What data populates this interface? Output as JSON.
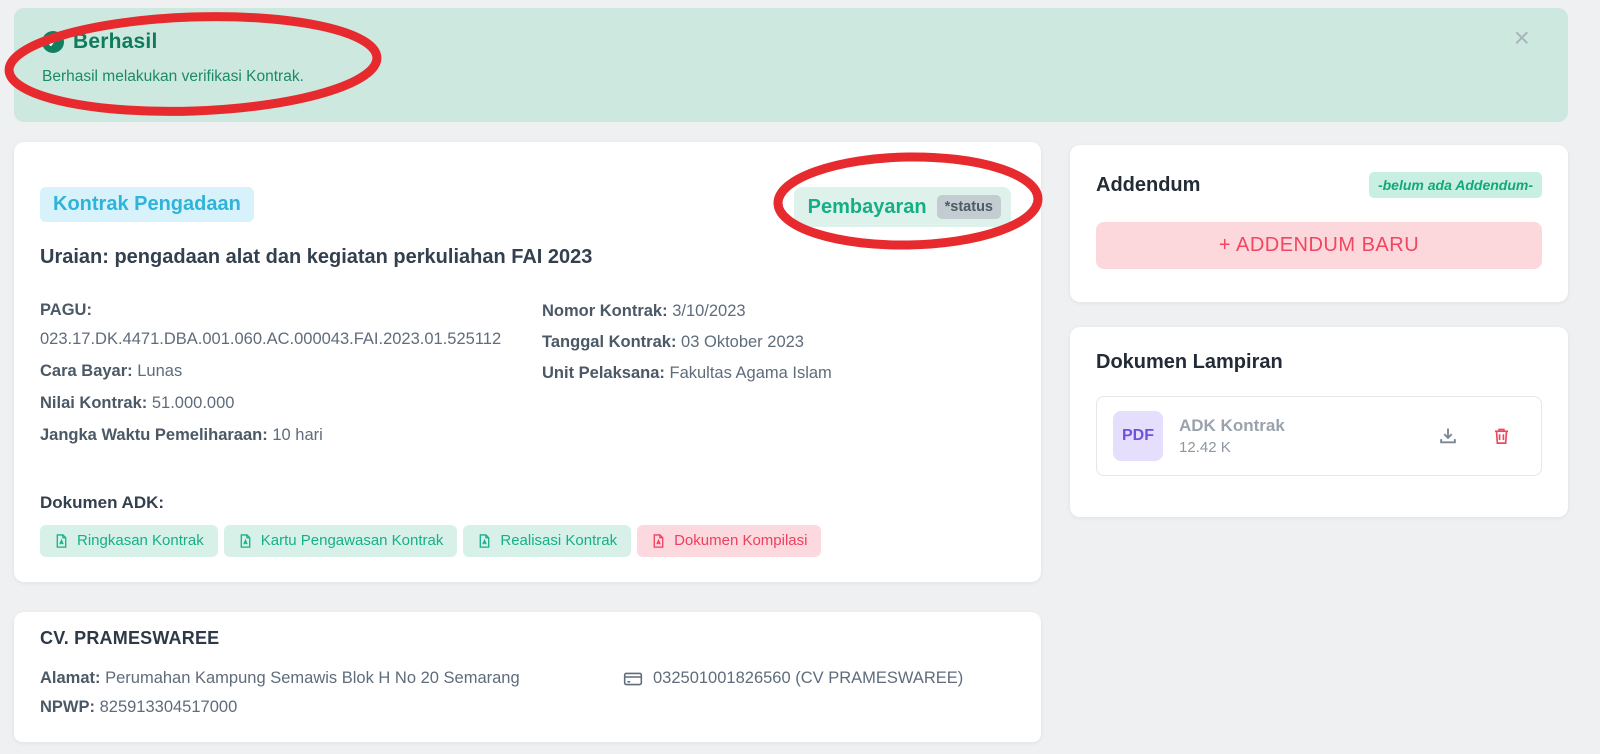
{
  "colors": {
    "page_bg": "#eef0f2",
    "alert_bg": "#cde8df",
    "alert_text": "#0f7a5c",
    "success_green": "#14b089",
    "info_cyan": "#2eb4d8",
    "danger_red": "#ef3e5e",
    "annotation_red": "#e62a2e",
    "pdf_purple": "#7050e0"
  },
  "alert": {
    "title": "Berhasil",
    "message": "Berhasil melakukan verifikasi Kontrak.",
    "close_glyph": "×"
  },
  "contract": {
    "type_badge": "Kontrak Pengadaan",
    "status_label": "Pembayaran",
    "status_note": "*status",
    "title": "Uraian: pengadaan alat dan kegiatan perkuliahan FAI 2023",
    "fields_left": [
      {
        "label": "PAGU:",
        "value": "023.17.DK.4471.DBA.001.060.AC.000043.FAI.2023.01.525112"
      },
      {
        "label": "Cara Bayar:",
        "value": "Lunas"
      },
      {
        "label": "Nilai Kontrak:",
        "value": "51.000.000"
      },
      {
        "label": "Jangka Waktu Pemeliharaan:",
        "value": "10 hari"
      }
    ],
    "fields_right": [
      {
        "label": "Nomor Kontrak:",
        "value": "3/10/2023"
      },
      {
        "label": "Tanggal Kontrak:",
        "value": "03 Oktober 2023"
      },
      {
        "label": "Unit Pelaksana:",
        "value": "Fakultas Agama Islam"
      }
    ],
    "adk_heading": "Dokumen ADK:",
    "adk_buttons": [
      {
        "label": "Ringkasan Kontrak",
        "variant": "green"
      },
      {
        "label": "Kartu Pengawasan Kontrak",
        "variant": "green"
      },
      {
        "label": "Realisasi Kontrak",
        "variant": "green"
      },
      {
        "label": "Dokumen Kompilasi",
        "variant": "red"
      }
    ]
  },
  "addendum": {
    "heading": "Addendum",
    "empty_badge": "-belum ada Addendum-",
    "new_button_label": "+ ADDENDUM BARU"
  },
  "attachments": {
    "heading": "Dokumen Lampiran",
    "files": [
      {
        "type": "PDF",
        "name": "ADK Kontrak",
        "size": "12.42 K"
      }
    ]
  },
  "vendor": {
    "name": "CV. PRAMESWAREE",
    "address_label": "Alamat:",
    "address": "Perumahan Kampung Semawis Blok H No 20 Semarang",
    "npwp_label": "NPWP:",
    "npwp": "825913304517000",
    "bank_account": "032501001826560 (CV PRAMESWAREE)"
  }
}
